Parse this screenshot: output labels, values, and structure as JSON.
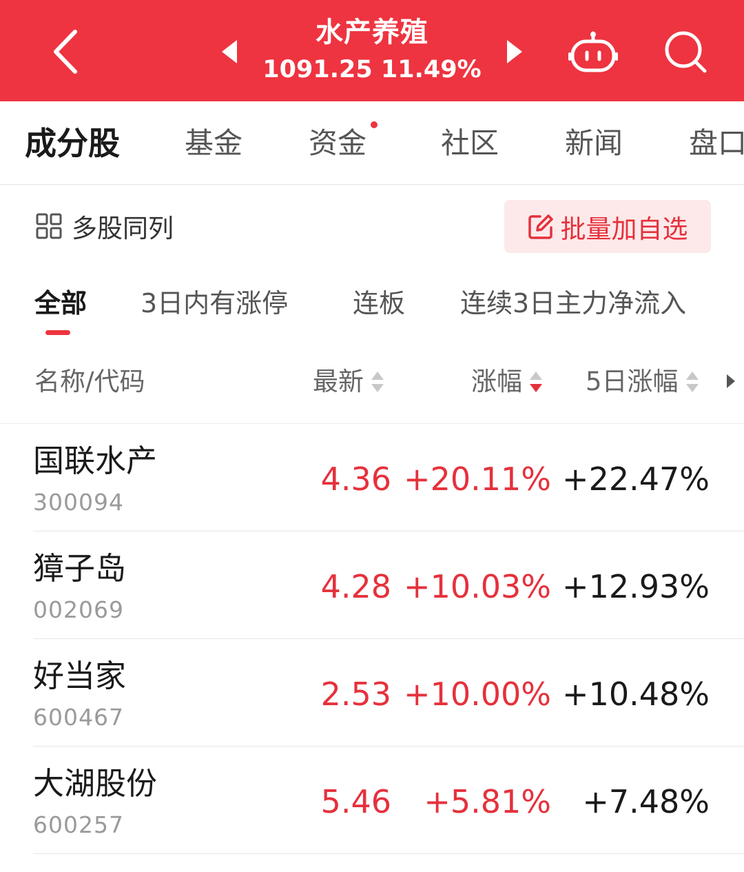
{
  "header": {
    "sector_name": "水产养殖",
    "index_value": "1091.25",
    "index_change": "11.49%",
    "background_color": "#ee3440",
    "icons": [
      "back-arrow-icon",
      "prev-sector-icon",
      "next-sector-icon",
      "robot-assistant-icon",
      "search-icon"
    ]
  },
  "main_tabs": [
    {
      "label": "成分股",
      "active": true
    },
    {
      "label": "基金"
    },
    {
      "label": "资金",
      "has_red_dot": true
    },
    {
      "label": "社区"
    },
    {
      "label": "新闻"
    },
    {
      "label": "盘口"
    }
  ],
  "toolbar": {
    "multi_compare_label": "多股同列",
    "batch_add_label": "批量加自选"
  },
  "filters": [
    {
      "label": "全部",
      "active": true
    },
    {
      "label": "3日内有涨停"
    },
    {
      "label": "连板"
    },
    {
      "label": "连续3日主力净流入"
    }
  ],
  "columns": {
    "name_code": "名称/代码",
    "latest": "最新",
    "change": "涨幅",
    "change_5d": "5日涨幅",
    "active_sort": "change_desc"
  },
  "rows": [
    {
      "name": "国联水产",
      "code": "300094",
      "price": "4.36",
      "change": "+20.11%",
      "change_5d": "+22.47%"
    },
    {
      "name": "獐子岛",
      "code": "002069",
      "price": "4.28",
      "change": "+10.03%",
      "change_5d": "+12.93%"
    },
    {
      "name": "好当家",
      "code": "600467",
      "price": "2.53",
      "change": "+10.00%",
      "change_5d": "+10.48%"
    },
    {
      "name": "大湖股份",
      "code": "600257",
      "price": "5.46",
      "change": "+5.81%",
      "change_5d": "+7.48%"
    }
  ],
  "colors": {
    "up": "#e5313c",
    "accent": "#ee3440",
    "batch_button_bg": "#fde9ea"
  }
}
